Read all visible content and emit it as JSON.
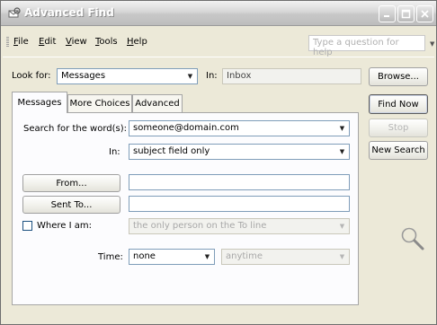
{
  "window": {
    "title": "Advanced Find"
  },
  "menu": [
    {
      "label": "File",
      "accel": "F",
      "rest": "ile"
    },
    {
      "label": "Edit",
      "accel": "E",
      "rest": "dit"
    },
    {
      "label": "View",
      "accel": "V",
      "rest": "iew"
    },
    {
      "label": "Tools",
      "accel": "T",
      "rest": "ools"
    },
    {
      "label": "Help",
      "accel": "H",
      "rest": "elp"
    }
  ],
  "help_box": {
    "placeholder": "Type a question for help"
  },
  "look_for": {
    "label": "Look for:",
    "value": "Messages"
  },
  "in": {
    "label": "In:",
    "value": "Inbox"
  },
  "buttons": {
    "browse": "Browse...",
    "find_now": "Find Now",
    "stop": "Stop",
    "new_search": "New Search"
  },
  "tabs": [
    "Messages",
    "More Choices",
    "Advanced"
  ],
  "search_words": {
    "label": "Search for the word(s):",
    "value": "someone@domain.com"
  },
  "in_field": {
    "label": "In:",
    "value": "subject field only"
  },
  "from_button": "From...",
  "sent_to_button": "Sent To...",
  "where_i_am": {
    "label": "Where I am:",
    "value": "the only person on the To line",
    "checked": false
  },
  "time": {
    "label": "Time:",
    "value": "none",
    "range": "anytime"
  },
  "icons": [
    "app-envelope-icon",
    "minimize-icon",
    "maximize-icon",
    "close-icon",
    "dropdown-arrow-icon",
    "magnifier-icon"
  ]
}
